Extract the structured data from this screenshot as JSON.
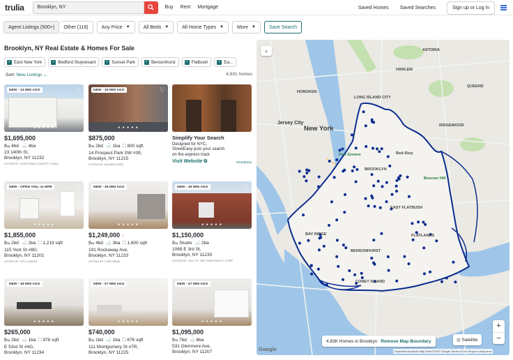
{
  "header": {
    "logo": "trulia",
    "search_value": "Brooklyn, NY",
    "nav": [
      "Buy",
      "Rent",
      "Mortgage"
    ],
    "saved_homes": "Saved Homes",
    "saved_searches": "Saved Searches",
    "signin": "Sign up or Log in"
  },
  "filters": {
    "agent_listings": "Agent Listings (500+)",
    "other": "Other (118)",
    "any_price": "Any Price",
    "all_beds": "All Beds",
    "all_home_types": "All Home Types",
    "more": "More",
    "save_search": "Save Search"
  },
  "results": {
    "title": "Brooklyn, NY Real Estate & Homes For Sale",
    "tags": [
      "East New York",
      "Bedford Stuyvesant",
      "Sunset Park",
      "Bensonhurst",
      "Flatbush",
      "Ea..."
    ],
    "sort_label": "Sort:",
    "sort_value": "New Listings",
    "count": "4,831 homes"
  },
  "cards": [
    {
      "badge": "NEW - 24 MIN AGO",
      "price": "$1,695,000",
      "beds": "4bd",
      "baths": "4ba",
      "sqft": "",
      "street": "23 140th St,",
      "city": "Brooklyn, NY 11232",
      "broker": "LISTING BY: CORCORAN COUNTRY LIVING"
    },
    {
      "badge": "NEW - 29 MIN AGO",
      "price": "$875,000",
      "beds": "2bd",
      "baths": "1ba",
      "sqft": "800 sqft",
      "street": "14 Prospect Park SW #39,",
      "city": "Brooklyn, NY 11215",
      "broker": "LISTING BY: KELMAS EDGE"
    },
    {
      "badge": "NEW - OPEN THU, 11-5PM",
      "price": "$1,855,000",
      "beds": "2bd",
      "baths": "2ba",
      "sqft": "1,219 sqft",
      "street": "115 York St #8G,",
      "city": "Brooklyn, NY 11201",
      "broker": "LISTING BY: CPH | UWKRK"
    },
    {
      "badge": "NEW - 38 MIN AGO",
      "price": "$1,249,000",
      "beds": "4bd",
      "baths": "3ba",
      "sqft": "1,600 sqft",
      "street": "191 Rockaway Ave,",
      "city": "Brooklyn, NY 11233",
      "broker": "LISTING BY: CORCORAN"
    },
    {
      "badge": "NEW - 49 MIN AGO",
      "price": "$1,150,000",
      "beds": "Studio",
      "baths": "2ba",
      "sqft": "",
      "street": "1069 E 3rd St,",
      "city": "Brooklyn, NY 11230",
      "broker": "LISTING BY: TALK OF THE TOWN REALTY CORP."
    },
    {
      "badge": "NEW - 49 MIN AGO",
      "price": "$265,000",
      "beds": "2bd",
      "baths": "1ba",
      "sqft": "978 sqft",
      "street": "E 53rd St #4G,",
      "city": "Brooklyn, NY 11234",
      "broker": ""
    },
    {
      "badge": "NEW - 57 MIN AGO",
      "price": "$740,000",
      "beds": "1bd",
      "baths": "1ba",
      "sqft": "676 sqft",
      "street": "111 Montgomery St #7R,",
      "city": "Brooklyn, NY 11225",
      "broker": ""
    },
    {
      "badge": "NEW - 57 MIN AGO",
      "price": "$1,095,000",
      "beds": "7bd",
      "baths": "6ba",
      "sqft": "",
      "street": "531 Glenmore Ave,",
      "city": "Brooklyn, NY 11207",
      "broker": ""
    }
  ],
  "ad": {
    "title": "Simplify Your Search",
    "text_1": "Designed for NYC,",
    "text_2": "StreetEasy puts your search",
    "text_3": "on the express track",
    "link": "Visit Website",
    "brand": "StreetEasy"
  },
  "map": {
    "status": "4.83K Homes in Brooklyn",
    "remove": "Remove Map Boundary",
    "satellite": "Satellite",
    "google": "Google",
    "attribution": "Keyboard shortcuts   Map Data ©2022 Google   Terms of Use   Report a map error",
    "labels": {
      "new_york": "New York",
      "jersey_city": "Jersey City",
      "brooklyn": "BROOKLYN",
      "fort_greene": "Fort Greene",
      "bed_stuy": "Bed-Stuy",
      "boerum_hill": "Boerum Hill",
      "hoboken": "HOBOKEN",
      "harlem": "HARLEM",
      "queens": "QUEENS",
      "astoria": "ASTORIA",
      "coney_island": "CONEY ISLAND",
      "flatlands": "FLATLANDS",
      "bensonhurst": "BENSONHURST",
      "bay_ridge": "BAY RIDGE",
      "east_flatbush": "EAST FLATBUSH",
      "ridgewood": "RIDGEWOOD",
      "lic": "LONG ISLAND CITY"
    }
  },
  "colors": {
    "accent": "#1c6d6d",
    "brand_red": "#e7443b",
    "boundary": "#0b2d8f",
    "marker": "#0b2d8f",
    "water": "#9fc6e8",
    "park": "#c4e0b0"
  }
}
